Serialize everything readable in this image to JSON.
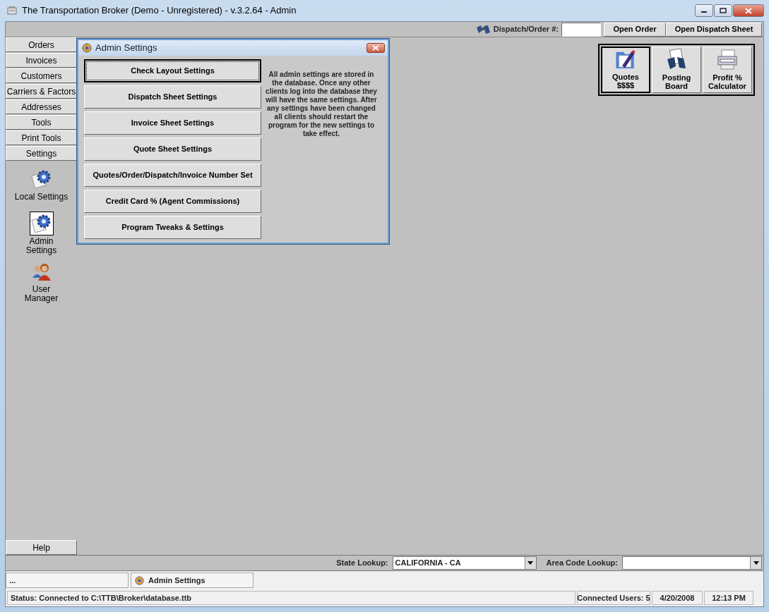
{
  "window": {
    "title": "The Transportation Broker (Demo - Unregistered) - v.3.2.64 - Admin"
  },
  "toolbar": {
    "dispatch_label": "Dispatch/Order #:",
    "buttons": [
      "Open Order",
      "Open Dispatch Sheet"
    ]
  },
  "nav": {
    "items": [
      "Orders",
      "Invoices",
      "Customers",
      "Carriers & Factors",
      "Addresses",
      "Tools",
      "Print Tools",
      "Settings"
    ]
  },
  "settings_panel": {
    "items": [
      {
        "kind": "gear",
        "lines": [
          "Local Settings"
        ],
        "selected": false
      },
      {
        "kind": "gear",
        "lines": [
          "Admin",
          "Settings"
        ],
        "selected": true
      },
      {
        "kind": "users",
        "lines": [
          "User",
          "Manager"
        ],
        "selected": false
      }
    ]
  },
  "quick_buttons": [
    {
      "kind": "quotes",
      "lines": [
        "Quotes",
        "$$$$"
      ],
      "selected": true
    },
    {
      "kind": "posting",
      "lines": [
        "Posting",
        "Board"
      ],
      "selected": false
    },
    {
      "kind": "calculator",
      "lines": [
        "Profit %",
        "Calculator"
      ],
      "selected": false
    }
  ],
  "dialog": {
    "title": "Admin Settings",
    "buttons": [
      {
        "label": "Check Layout Settings",
        "focused": true
      },
      {
        "label": "Dispatch Sheet Settings",
        "focused": false
      },
      {
        "label": "Invoice Sheet Settings",
        "focused": false
      },
      {
        "label": "Quote Sheet Settings",
        "focused": false
      },
      {
        "label": "Quotes/Order/Dispatch/Invoice Number Set",
        "focused": false
      },
      {
        "label": "Credit Card % (Agent Commissions)",
        "focused": false
      },
      {
        "label": "Program Tweaks & Settings",
        "focused": false
      }
    ],
    "note": "All admin settings are stored in the database. Once any other clients log into the database they will have the same settings. After any settings have been changed all clients should restart the program for the new settings to take effect."
  },
  "help_button": "Help",
  "lookups": [
    {
      "label": "State Lookup:",
      "value": "CALIFORNIA - CA"
    },
    {
      "label": "Area Code Lookup:"
    }
  ],
  "taskbar": [
    {
      "kind": "plain",
      "label": "..."
    },
    {
      "kind": "app",
      "label": "Admin Settings"
    }
  ],
  "status_bar": {
    "status": "Status: Connected to C:\\TTB\\Broker\\database.ttb",
    "connected_users": "Connected Users: 5",
    "date": "4/20/2008",
    "time": "12:13 PM"
  }
}
